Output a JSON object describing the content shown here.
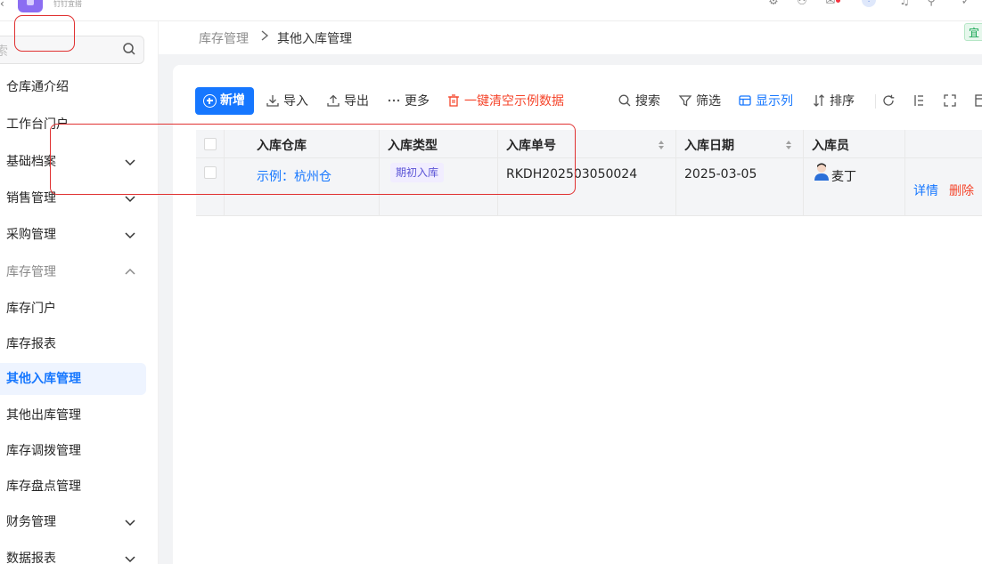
{
  "topbar": {
    "logo_text": "钉钉宜搭",
    "icons": [
      "settings-icon",
      "users-icon",
      "mail-icon",
      "info-icon",
      "bell-icon",
      "user-add-icon",
      "check-icon"
    ],
    "info_badge": "!"
  },
  "sidebar": {
    "search_placeholder": "索",
    "items": [
      {
        "label": "仓库通介绍",
        "state": "normal"
      },
      {
        "label": "工作台门户",
        "state": "normal"
      },
      {
        "label": "基础档案",
        "state": "collapsed"
      },
      {
        "label": "销售管理",
        "state": "collapsed"
      },
      {
        "label": "采购管理",
        "state": "collapsed"
      },
      {
        "label": "库存管理",
        "state": "expanded"
      },
      {
        "label": "库存门户",
        "state": "normal"
      },
      {
        "label": "库存报表",
        "state": "normal"
      },
      {
        "label": "其他入库管理",
        "state": "active"
      },
      {
        "label": "其他出库管理",
        "state": "normal"
      },
      {
        "label": "库存调拨管理",
        "state": "normal"
      },
      {
        "label": "库存盘点管理",
        "state": "normal"
      },
      {
        "label": "财务管理",
        "state": "collapsed"
      },
      {
        "label": "数据报表",
        "state": "collapsed"
      }
    ]
  },
  "breadcrumb": {
    "parent": "库存管理",
    "current": "其他入库管理"
  },
  "env_tag": "宜",
  "toolbar": {
    "new_label": "新增",
    "import_label": "导入",
    "export_label": "导出",
    "more_label": "更多",
    "clear_label": "一键清空示例数据",
    "search_label": "搜索",
    "filter_label": "筛选",
    "columns_label": "显示列",
    "sort_label": "排序"
  },
  "table": {
    "headers": [
      "入库仓库",
      "入库类型",
      "入库单号",
      "入库日期",
      "入库员"
    ],
    "rows": [
      {
        "warehouse": "示例：杭州仓",
        "type": "期初入库",
        "order_no": "RKDH202503050024",
        "date": "2025-03-05",
        "operator": "麦丁",
        "actions": [
          "详情",
          "删除"
        ]
      }
    ]
  },
  "colors": {
    "primary": "#1677ff",
    "danger": "#f5452b",
    "highlight": "#e03131",
    "tag_bg": "#f1edff",
    "tag_fg": "#5b54d6"
  }
}
